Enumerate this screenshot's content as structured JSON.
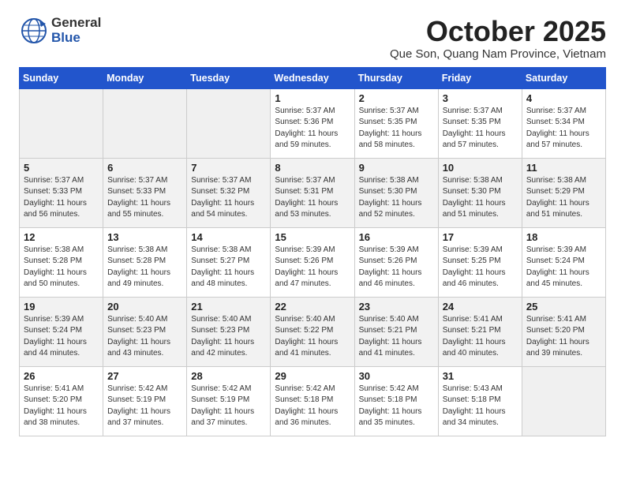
{
  "logo": {
    "general": "General",
    "blue": "Blue"
  },
  "header": {
    "month": "October 2025",
    "location": "Que Son, Quang Nam Province, Vietnam"
  },
  "weekdays": [
    "Sunday",
    "Monday",
    "Tuesday",
    "Wednesday",
    "Thursday",
    "Friday",
    "Saturday"
  ],
  "weeks": [
    [
      {
        "day": "",
        "info": ""
      },
      {
        "day": "",
        "info": ""
      },
      {
        "day": "",
        "info": ""
      },
      {
        "day": "1",
        "info": "Sunrise: 5:37 AM\nSunset: 5:36 PM\nDaylight: 11 hours\nand 59 minutes."
      },
      {
        "day": "2",
        "info": "Sunrise: 5:37 AM\nSunset: 5:35 PM\nDaylight: 11 hours\nand 58 minutes."
      },
      {
        "day": "3",
        "info": "Sunrise: 5:37 AM\nSunset: 5:35 PM\nDaylight: 11 hours\nand 57 minutes."
      },
      {
        "day": "4",
        "info": "Sunrise: 5:37 AM\nSunset: 5:34 PM\nDaylight: 11 hours\nand 57 minutes."
      }
    ],
    [
      {
        "day": "5",
        "info": "Sunrise: 5:37 AM\nSunset: 5:33 PM\nDaylight: 11 hours\nand 56 minutes."
      },
      {
        "day": "6",
        "info": "Sunrise: 5:37 AM\nSunset: 5:33 PM\nDaylight: 11 hours\nand 55 minutes."
      },
      {
        "day": "7",
        "info": "Sunrise: 5:37 AM\nSunset: 5:32 PM\nDaylight: 11 hours\nand 54 minutes."
      },
      {
        "day": "8",
        "info": "Sunrise: 5:37 AM\nSunset: 5:31 PM\nDaylight: 11 hours\nand 53 minutes."
      },
      {
        "day": "9",
        "info": "Sunrise: 5:38 AM\nSunset: 5:30 PM\nDaylight: 11 hours\nand 52 minutes."
      },
      {
        "day": "10",
        "info": "Sunrise: 5:38 AM\nSunset: 5:30 PM\nDaylight: 11 hours\nand 51 minutes."
      },
      {
        "day": "11",
        "info": "Sunrise: 5:38 AM\nSunset: 5:29 PM\nDaylight: 11 hours\nand 51 minutes."
      }
    ],
    [
      {
        "day": "12",
        "info": "Sunrise: 5:38 AM\nSunset: 5:28 PM\nDaylight: 11 hours\nand 50 minutes."
      },
      {
        "day": "13",
        "info": "Sunrise: 5:38 AM\nSunset: 5:28 PM\nDaylight: 11 hours\nand 49 minutes."
      },
      {
        "day": "14",
        "info": "Sunrise: 5:38 AM\nSunset: 5:27 PM\nDaylight: 11 hours\nand 48 minutes."
      },
      {
        "day": "15",
        "info": "Sunrise: 5:39 AM\nSunset: 5:26 PM\nDaylight: 11 hours\nand 47 minutes."
      },
      {
        "day": "16",
        "info": "Sunrise: 5:39 AM\nSunset: 5:26 PM\nDaylight: 11 hours\nand 46 minutes."
      },
      {
        "day": "17",
        "info": "Sunrise: 5:39 AM\nSunset: 5:25 PM\nDaylight: 11 hours\nand 46 minutes."
      },
      {
        "day": "18",
        "info": "Sunrise: 5:39 AM\nSunset: 5:24 PM\nDaylight: 11 hours\nand 45 minutes."
      }
    ],
    [
      {
        "day": "19",
        "info": "Sunrise: 5:39 AM\nSunset: 5:24 PM\nDaylight: 11 hours\nand 44 minutes."
      },
      {
        "day": "20",
        "info": "Sunrise: 5:40 AM\nSunset: 5:23 PM\nDaylight: 11 hours\nand 43 minutes."
      },
      {
        "day": "21",
        "info": "Sunrise: 5:40 AM\nSunset: 5:23 PM\nDaylight: 11 hours\nand 42 minutes."
      },
      {
        "day": "22",
        "info": "Sunrise: 5:40 AM\nSunset: 5:22 PM\nDaylight: 11 hours\nand 41 minutes."
      },
      {
        "day": "23",
        "info": "Sunrise: 5:40 AM\nSunset: 5:21 PM\nDaylight: 11 hours\nand 41 minutes."
      },
      {
        "day": "24",
        "info": "Sunrise: 5:41 AM\nSunset: 5:21 PM\nDaylight: 11 hours\nand 40 minutes."
      },
      {
        "day": "25",
        "info": "Sunrise: 5:41 AM\nSunset: 5:20 PM\nDaylight: 11 hours\nand 39 minutes."
      }
    ],
    [
      {
        "day": "26",
        "info": "Sunrise: 5:41 AM\nSunset: 5:20 PM\nDaylight: 11 hours\nand 38 minutes."
      },
      {
        "day": "27",
        "info": "Sunrise: 5:42 AM\nSunset: 5:19 PM\nDaylight: 11 hours\nand 37 minutes."
      },
      {
        "day": "28",
        "info": "Sunrise: 5:42 AM\nSunset: 5:19 PM\nDaylight: 11 hours\nand 37 minutes."
      },
      {
        "day": "29",
        "info": "Sunrise: 5:42 AM\nSunset: 5:18 PM\nDaylight: 11 hours\nand 36 minutes."
      },
      {
        "day": "30",
        "info": "Sunrise: 5:42 AM\nSunset: 5:18 PM\nDaylight: 11 hours\nand 35 minutes."
      },
      {
        "day": "31",
        "info": "Sunrise: 5:43 AM\nSunset: 5:18 PM\nDaylight: 11 hours\nand 34 minutes."
      },
      {
        "day": "",
        "info": ""
      }
    ]
  ]
}
